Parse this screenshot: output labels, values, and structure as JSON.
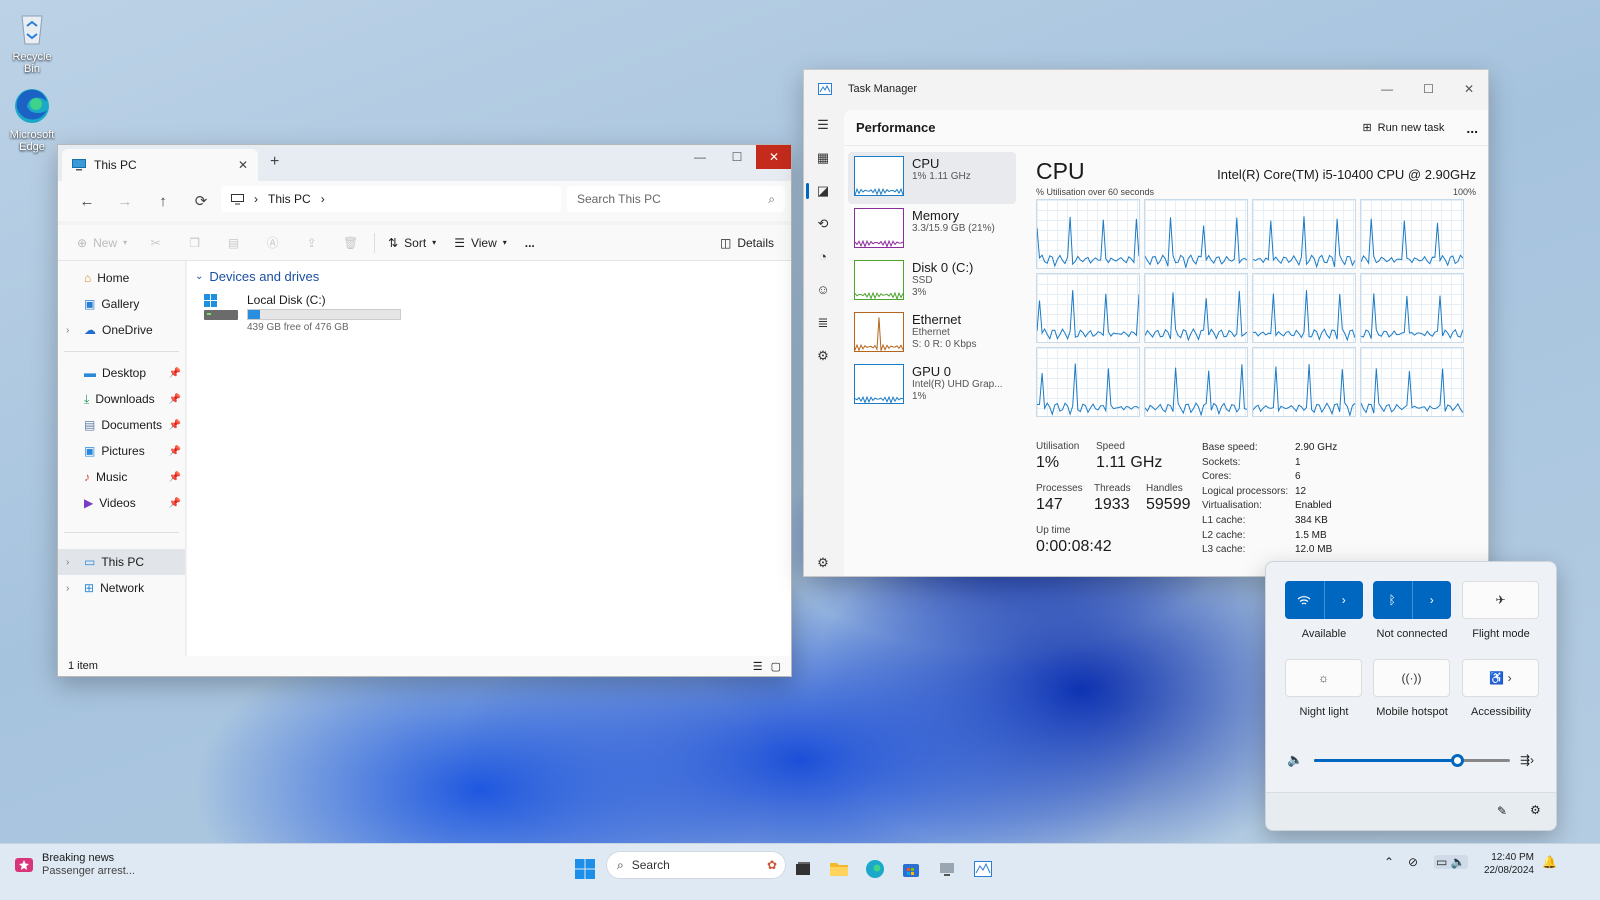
{
  "desktop": {
    "icons": [
      {
        "label": "Recycle Bin",
        "icon": "recycle-bin-icon"
      },
      {
        "label": "Microsoft Edge",
        "icon": "edge-icon"
      }
    ]
  },
  "explorer": {
    "tab_title": "This PC",
    "new_tab": "+",
    "breadcrumb": "This PC",
    "search_placeholder": "Search This PC",
    "toolbar": {
      "new": "New",
      "sort": "Sort",
      "view": "View",
      "more": "...",
      "details": "Details"
    },
    "sidebar": {
      "top": [
        {
          "label": "Home",
          "icon": "home-icon"
        },
        {
          "label": "Gallery",
          "icon": "gallery-icon"
        },
        {
          "label": "OneDrive",
          "icon": "onedrive-icon"
        }
      ],
      "pinned": [
        {
          "label": "Desktop",
          "icon": "desktop-folder-icon"
        },
        {
          "label": "Downloads",
          "icon": "downloads-icon"
        },
        {
          "label": "Documents",
          "icon": "documents-icon"
        },
        {
          "label": "Pictures",
          "icon": "pictures-icon"
        },
        {
          "label": "Music",
          "icon": "music-icon"
        },
        {
          "label": "Videos",
          "icon": "videos-icon"
        }
      ],
      "bottom": [
        {
          "label": "This PC",
          "icon": "this-pc-icon",
          "selected": true
        },
        {
          "label": "Network",
          "icon": "network-icon"
        }
      ]
    },
    "group_header": "Devices and drives",
    "drive": {
      "name": "Local Disk (C:)",
      "free": "439 GB free of 476 GB",
      "used_fraction": 0.078
    },
    "status": "1 item"
  },
  "taskmgr": {
    "title": "Task Manager",
    "section": "Performance",
    "run_new_task": "Run new task",
    "more": "...",
    "resources": [
      {
        "name": "CPU",
        "sub1": "1% 1.11 GHz",
        "sub2": "",
        "color": "#1c7bc4",
        "selected": true
      },
      {
        "name": "Memory",
        "sub1": "3.3/15.9 GB (21%)",
        "sub2": "",
        "color": "#8b2c9c"
      },
      {
        "name": "Disk 0 (C:)",
        "sub1": "SSD",
        "sub2": "3%",
        "color": "#4ca32d"
      },
      {
        "name": "Ethernet",
        "sub1": "Ethernet",
        "sub2": "S: 0 R: 0 Kbps",
        "color": "#b4661f"
      },
      {
        "name": "GPU 0",
        "sub1": "Intel(R) UHD Grap...",
        "sub2": "1%",
        "color": "#1c7bc4"
      }
    ],
    "cpu": {
      "heading": "CPU",
      "model": "Intel(R) Core(TM) i5-10400 CPU @ 2.90GHz",
      "graph_label": "% Utilisation over 60 seconds",
      "graph_max": "100%",
      "core_count_graphs": 12
    },
    "stats": {
      "utilisation_label": "Utilisation",
      "utilisation": "1%",
      "speed_label": "Speed",
      "speed": "1.11 GHz",
      "processes_label": "Processes",
      "processes": "147",
      "threads_label": "Threads",
      "threads": "1933",
      "handles_label": "Handles",
      "handles": "59599",
      "uptime_label": "Up time",
      "uptime": "0:00:08:42"
    },
    "specs": [
      {
        "k": "Base speed:",
        "v": "2.90 GHz"
      },
      {
        "k": "Sockets:",
        "v": "1"
      },
      {
        "k": "Cores:",
        "v": "6"
      },
      {
        "k": "Logical processors:",
        "v": "12"
      },
      {
        "k": "Virtualisation:",
        "v": "Enabled"
      },
      {
        "k": "L1 cache:",
        "v": "384 KB"
      },
      {
        "k": "L2 cache:",
        "v": "1.5 MB"
      },
      {
        "k": "L3 cache:",
        "v": "12.0 MB"
      }
    ]
  },
  "quick_settings": {
    "tiles": [
      {
        "label": "Available",
        "icon": "wifi-icon"
      },
      {
        "label": "Not connected",
        "icon": "bluetooth-icon"
      },
      {
        "label": "Flight mode",
        "icon": "airplane-icon"
      },
      {
        "label": "Night light",
        "icon": "night-light-icon"
      },
      {
        "label": "Mobile hotspot",
        "icon": "hotspot-icon"
      },
      {
        "label": "Accessibility",
        "icon": "accessibility-icon"
      }
    ],
    "volume_level": 0.73
  },
  "taskbar": {
    "news_title": "Breaking news",
    "news_sub": "Passenger arrest...",
    "search_placeholder": "Search",
    "time": "12:40 PM",
    "date": "22/08/2024"
  },
  "colors": {
    "accent": "#0067c0",
    "close_red": "#c42b1c",
    "cpu_line": "#1c7bc4"
  }
}
